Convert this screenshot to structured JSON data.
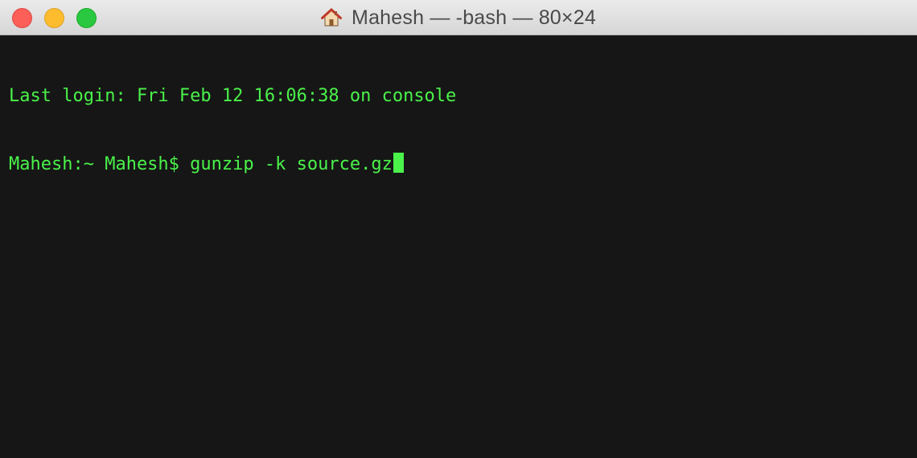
{
  "window": {
    "title": "Mahesh — -bash — 80×24"
  },
  "terminal": {
    "lines": [
      "Last login: Fri Feb 12 16:06:38 on console",
      "Mahesh:~ Mahesh$ gunzip -k source.gz"
    ]
  },
  "colors": {
    "text": "#4af24a",
    "background": "#161616"
  }
}
